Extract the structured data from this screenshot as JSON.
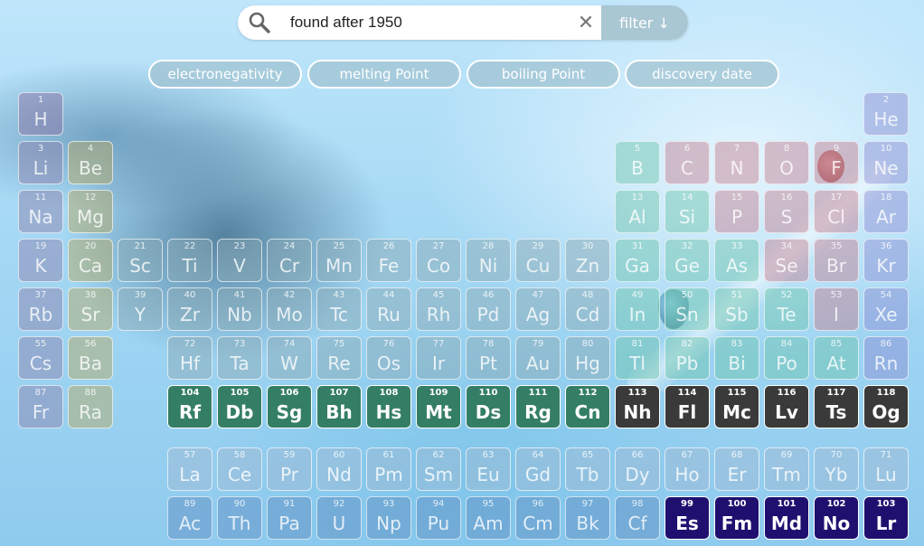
{
  "search": {
    "value": "found after 1950",
    "clear_label": "✕",
    "filter_label": "filter ↓"
  },
  "sort_buttons": [
    {
      "label": "electronegativity"
    },
    {
      "label": "melting Point"
    },
    {
      "label": "boiling Point"
    },
    {
      "label": "discovery date"
    }
  ],
  "colors": {
    "alkali": "#8a7ca8",
    "alkaline": "#b9a65c",
    "transition": "#8aa7b0",
    "post_transition": "#6bc4a8",
    "metalloid": "#6bc4a8",
    "nonmetal": "#c07a8c",
    "halogen": "#c07a8c",
    "noble": "#8a8ad0",
    "hydrogen": "#8a6ca0",
    "lanthanide": "#9fb8d0",
    "actinide": "#5a8abf",
    "hl_transition": "#357e66",
    "hl_unknown": "#3a3a3a",
    "hl_actinide": "#1f1070"
  },
  "elements": [
    {
      "n": "1",
      "s": "H",
      "c": "hydrogen",
      "r": 1,
      "g": 1
    },
    {
      "n": "2",
      "s": "He",
      "c": "noble",
      "r": 1,
      "g": 18
    },
    {
      "n": "3",
      "s": "Li",
      "c": "alkali",
      "r": 2,
      "g": 1
    },
    {
      "n": "4",
      "s": "Be",
      "c": "alkaline",
      "r": 2,
      "g": 2
    },
    {
      "n": "5",
      "s": "B",
      "c": "metalloid",
      "r": 2,
      "g": 13
    },
    {
      "n": "6",
      "s": "C",
      "c": "nonmetal",
      "r": 2,
      "g": 14
    },
    {
      "n": "7",
      "s": "N",
      "c": "nonmetal",
      "r": 2,
      "g": 15
    },
    {
      "n": "8",
      "s": "O",
      "c": "nonmetal",
      "r": 2,
      "g": 16
    },
    {
      "n": "9",
      "s": "F",
      "c": "halogen",
      "r": 2,
      "g": 17
    },
    {
      "n": "10",
      "s": "Ne",
      "c": "noble",
      "r": 2,
      "g": 18
    },
    {
      "n": "11",
      "s": "Na",
      "c": "alkali",
      "r": 3,
      "g": 1
    },
    {
      "n": "12",
      "s": "Mg",
      "c": "alkaline",
      "r": 3,
      "g": 2
    },
    {
      "n": "13",
      "s": "Al",
      "c": "post_transition",
      "r": 3,
      "g": 13
    },
    {
      "n": "14",
      "s": "Si",
      "c": "metalloid",
      "r": 3,
      "g": 14
    },
    {
      "n": "15",
      "s": "P",
      "c": "nonmetal",
      "r": 3,
      "g": 15
    },
    {
      "n": "16",
      "s": "S",
      "c": "nonmetal",
      "r": 3,
      "g": 16
    },
    {
      "n": "17",
      "s": "Cl",
      "c": "halogen",
      "r": 3,
      "g": 17
    },
    {
      "n": "18",
      "s": "Ar",
      "c": "noble",
      "r": 3,
      "g": 18
    },
    {
      "n": "19",
      "s": "K",
      "c": "alkali",
      "r": 4,
      "g": 1
    },
    {
      "n": "20",
      "s": "Ca",
      "c": "alkaline",
      "r": 4,
      "g": 2
    },
    {
      "n": "21",
      "s": "Sc",
      "c": "transition",
      "r": 4,
      "g": 3
    },
    {
      "n": "22",
      "s": "Ti",
      "c": "transition",
      "r": 4,
      "g": 4
    },
    {
      "n": "23",
      "s": "V",
      "c": "transition",
      "r": 4,
      "g": 5
    },
    {
      "n": "24",
      "s": "Cr",
      "c": "transition",
      "r": 4,
      "g": 6
    },
    {
      "n": "25",
      "s": "Mn",
      "c": "transition",
      "r": 4,
      "g": 7
    },
    {
      "n": "26",
      "s": "Fe",
      "c": "transition",
      "r": 4,
      "g": 8
    },
    {
      "n": "27",
      "s": "Co",
      "c": "transition",
      "r": 4,
      "g": 9
    },
    {
      "n": "28",
      "s": "Ni",
      "c": "transition",
      "r": 4,
      "g": 10
    },
    {
      "n": "29",
      "s": "Cu",
      "c": "transition",
      "r": 4,
      "g": 11
    },
    {
      "n": "30",
      "s": "Zn",
      "c": "transition",
      "r": 4,
      "g": 12
    },
    {
      "n": "31",
      "s": "Ga",
      "c": "post_transition",
      "r": 4,
      "g": 13
    },
    {
      "n": "32",
      "s": "Ge",
      "c": "metalloid",
      "r": 4,
      "g": 14
    },
    {
      "n": "33",
      "s": "As",
      "c": "metalloid",
      "r": 4,
      "g": 15
    },
    {
      "n": "34",
      "s": "Se",
      "c": "nonmetal",
      "r": 4,
      "g": 16
    },
    {
      "n": "35",
      "s": "Br",
      "c": "halogen",
      "r": 4,
      "g": 17
    },
    {
      "n": "36",
      "s": "Kr",
      "c": "noble",
      "r": 4,
      "g": 18
    },
    {
      "n": "37",
      "s": "Rb",
      "c": "alkali",
      "r": 5,
      "g": 1
    },
    {
      "n": "38",
      "s": "Sr",
      "c": "alkaline",
      "r": 5,
      "g": 2
    },
    {
      "n": "39",
      "s": "Y",
      "c": "transition",
      "r": 5,
      "g": 3
    },
    {
      "n": "40",
      "s": "Zr",
      "c": "transition",
      "r": 5,
      "g": 4
    },
    {
      "n": "41",
      "s": "Nb",
      "c": "transition",
      "r": 5,
      "g": 5
    },
    {
      "n": "42",
      "s": "Mo",
      "c": "transition",
      "r": 5,
      "g": 6
    },
    {
      "n": "43",
      "s": "Tc",
      "c": "transition",
      "r": 5,
      "g": 7
    },
    {
      "n": "44",
      "s": "Ru",
      "c": "transition",
      "r": 5,
      "g": 8
    },
    {
      "n": "45",
      "s": "Rh",
      "c": "transition",
      "r": 5,
      "g": 9
    },
    {
      "n": "46",
      "s": "Pd",
      "c": "transition",
      "r": 5,
      "g": 10
    },
    {
      "n": "47",
      "s": "Ag",
      "c": "transition",
      "r": 5,
      "g": 11
    },
    {
      "n": "48",
      "s": "Cd",
      "c": "transition",
      "r": 5,
      "g": 12
    },
    {
      "n": "49",
      "s": "In",
      "c": "post_transition",
      "r": 5,
      "g": 13
    },
    {
      "n": "50",
      "s": "Sn",
      "c": "post_transition",
      "r": 5,
      "g": 14
    },
    {
      "n": "51",
      "s": "Sb",
      "c": "metalloid",
      "r": 5,
      "g": 15
    },
    {
      "n": "52",
      "s": "Te",
      "c": "metalloid",
      "r": 5,
      "g": 16
    },
    {
      "n": "53",
      "s": "I",
      "c": "halogen",
      "r": 5,
      "g": 17
    },
    {
      "n": "54",
      "s": "Xe",
      "c": "noble",
      "r": 5,
      "g": 18
    },
    {
      "n": "55",
      "s": "Cs",
      "c": "alkali",
      "r": 6,
      "g": 1
    },
    {
      "n": "56",
      "s": "Ba",
      "c": "alkaline",
      "r": 6,
      "g": 2
    },
    {
      "n": "72",
      "s": "Hf",
      "c": "transition",
      "r": 6,
      "g": 4
    },
    {
      "n": "73",
      "s": "Ta",
      "c": "transition",
      "r": 6,
      "g": 5
    },
    {
      "n": "74",
      "s": "W",
      "c": "transition",
      "r": 6,
      "g": 6
    },
    {
      "n": "75",
      "s": "Re",
      "c": "transition",
      "r": 6,
      "g": 7
    },
    {
      "n": "76",
      "s": "Os",
      "c": "transition",
      "r": 6,
      "g": 8
    },
    {
      "n": "77",
      "s": "Ir",
      "c": "transition",
      "r": 6,
      "g": 9
    },
    {
      "n": "78",
      "s": "Pt",
      "c": "transition",
      "r": 6,
      "g": 10
    },
    {
      "n": "79",
      "s": "Au",
      "c": "transition",
      "r": 6,
      "g": 11
    },
    {
      "n": "80",
      "s": "Hg",
      "c": "transition",
      "r": 6,
      "g": 12
    },
    {
      "n": "81",
      "s": "Tl",
      "c": "post_transition",
      "r": 6,
      "g": 13
    },
    {
      "n": "82",
      "s": "Pb",
      "c": "post_transition",
      "r": 6,
      "g": 14
    },
    {
      "n": "83",
      "s": "Bi",
      "c": "post_transition",
      "r": 6,
      "g": 15
    },
    {
      "n": "84",
      "s": "Po",
      "c": "post_transition",
      "r": 6,
      "g": 16
    },
    {
      "n": "85",
      "s": "At",
      "c": "metalloid",
      "r": 6,
      "g": 17
    },
    {
      "n": "86",
      "s": "Rn",
      "c": "noble",
      "r": 6,
      "g": 18
    },
    {
      "n": "87",
      "s": "Fr",
      "c": "alkali",
      "r": 7,
      "g": 1
    },
    {
      "n": "88",
      "s": "Ra",
      "c": "alkaline",
      "r": 7,
      "g": 2
    },
    {
      "n": "104",
      "s": "Rf",
      "c": "hl_transition",
      "r": 7,
      "g": 4,
      "hl": true
    },
    {
      "n": "105",
      "s": "Db",
      "c": "hl_transition",
      "r": 7,
      "g": 5,
      "hl": true
    },
    {
      "n": "106",
      "s": "Sg",
      "c": "hl_transition",
      "r": 7,
      "g": 6,
      "hl": true
    },
    {
      "n": "107",
      "s": "Bh",
      "c": "hl_transition",
      "r": 7,
      "g": 7,
      "hl": true
    },
    {
      "n": "108",
      "s": "Hs",
      "c": "hl_transition",
      "r": 7,
      "g": 8,
      "hl": true
    },
    {
      "n": "109",
      "s": "Mt",
      "c": "hl_transition",
      "r": 7,
      "g": 9,
      "hl": true
    },
    {
      "n": "110",
      "s": "Ds",
      "c": "hl_transition",
      "r": 7,
      "g": 10,
      "hl": true
    },
    {
      "n": "111",
      "s": "Rg",
      "c": "hl_transition",
      "r": 7,
      "g": 11,
      "hl": true
    },
    {
      "n": "112",
      "s": "Cn",
      "c": "hl_transition",
      "r": 7,
      "g": 12,
      "hl": true
    },
    {
      "n": "113",
      "s": "Nh",
      "c": "hl_unknown",
      "r": 7,
      "g": 13,
      "hl": true
    },
    {
      "n": "114",
      "s": "Fl",
      "c": "hl_unknown",
      "r": 7,
      "g": 14,
      "hl": true
    },
    {
      "n": "115",
      "s": "Mc",
      "c": "hl_unknown",
      "r": 7,
      "g": 15,
      "hl": true
    },
    {
      "n": "116",
      "s": "Lv",
      "c": "hl_unknown",
      "r": 7,
      "g": 16,
      "hl": true
    },
    {
      "n": "117",
      "s": "Ts",
      "c": "hl_unknown",
      "r": 7,
      "g": 17,
      "hl": true
    },
    {
      "n": "118",
      "s": "Og",
      "c": "hl_unknown",
      "r": 7,
      "g": 18,
      "hl": true
    },
    {
      "n": "57",
      "s": "La",
      "c": "lanthanide",
      "r": 9,
      "g": 4
    },
    {
      "n": "58",
      "s": "Ce",
      "c": "lanthanide",
      "r": 9,
      "g": 5
    },
    {
      "n": "59",
      "s": "Pr",
      "c": "lanthanide",
      "r": 9,
      "g": 6
    },
    {
      "n": "60",
      "s": "Nd",
      "c": "lanthanide",
      "r": 9,
      "g": 7
    },
    {
      "n": "61",
      "s": "Pm",
      "c": "lanthanide",
      "r": 9,
      "g": 8
    },
    {
      "n": "62",
      "s": "Sm",
      "c": "lanthanide",
      "r": 9,
      "g": 9
    },
    {
      "n": "63",
      "s": "Eu",
      "c": "lanthanide",
      "r": 9,
      "g": 10
    },
    {
      "n": "64",
      "s": "Gd",
      "c": "lanthanide",
      "r": 9,
      "g": 11
    },
    {
      "n": "65",
      "s": "Tb",
      "c": "lanthanide",
      "r": 9,
      "g": 12
    },
    {
      "n": "66",
      "s": "Dy",
      "c": "lanthanide",
      "r": 9,
      "g": 13
    },
    {
      "n": "67",
      "s": "Ho",
      "c": "lanthanide",
      "r": 9,
      "g": 14
    },
    {
      "n": "68",
      "s": "Er",
      "c": "lanthanide",
      "r": 9,
      "g": 15
    },
    {
      "n": "69",
      "s": "Tm",
      "c": "lanthanide",
      "r": 9,
      "g": 16
    },
    {
      "n": "70",
      "s": "Yb",
      "c": "lanthanide",
      "r": 9,
      "g": 17
    },
    {
      "n": "71",
      "s": "Lu",
      "c": "lanthanide",
      "r": 9,
      "g": 18
    },
    {
      "n": "89",
      "s": "Ac",
      "c": "actinide",
      "r": 10,
      "g": 4
    },
    {
      "n": "90",
      "s": "Th",
      "c": "actinide",
      "r": 10,
      "g": 5
    },
    {
      "n": "91",
      "s": "Pa",
      "c": "actinide",
      "r": 10,
      "g": 6
    },
    {
      "n": "92",
      "s": "U",
      "c": "actinide",
      "r": 10,
      "g": 7
    },
    {
      "n": "93",
      "s": "Np",
      "c": "actinide",
      "r": 10,
      "g": 8
    },
    {
      "n": "94",
      "s": "Pu",
      "c": "actinide",
      "r": 10,
      "g": 9
    },
    {
      "n": "95",
      "s": "Am",
      "c": "actinide",
      "r": 10,
      "g": 10
    },
    {
      "n": "96",
      "s": "Cm",
      "c": "actinide",
      "r": 10,
      "g": 11
    },
    {
      "n": "97",
      "s": "Bk",
      "c": "actinide",
      "r": 10,
      "g": 12
    },
    {
      "n": "98",
      "s": "Cf",
      "c": "actinide",
      "r": 10,
      "g": 13
    },
    {
      "n": "99",
      "s": "Es",
      "c": "hl_actinide",
      "r": 10,
      "g": 14,
      "hl": true
    },
    {
      "n": "100",
      "s": "Fm",
      "c": "hl_actinide",
      "r": 10,
      "g": 15,
      "hl": true
    },
    {
      "n": "101",
      "s": "Md",
      "c": "hl_actinide",
      "r": 10,
      "g": 16,
      "hl": true
    },
    {
      "n": "102",
      "s": "No",
      "c": "hl_actinide",
      "r": 10,
      "g": 17,
      "hl": true
    },
    {
      "n": "103",
      "s": "Lr",
      "c": "hl_actinide",
      "r": 10,
      "g": 18,
      "hl": true
    }
  ]
}
